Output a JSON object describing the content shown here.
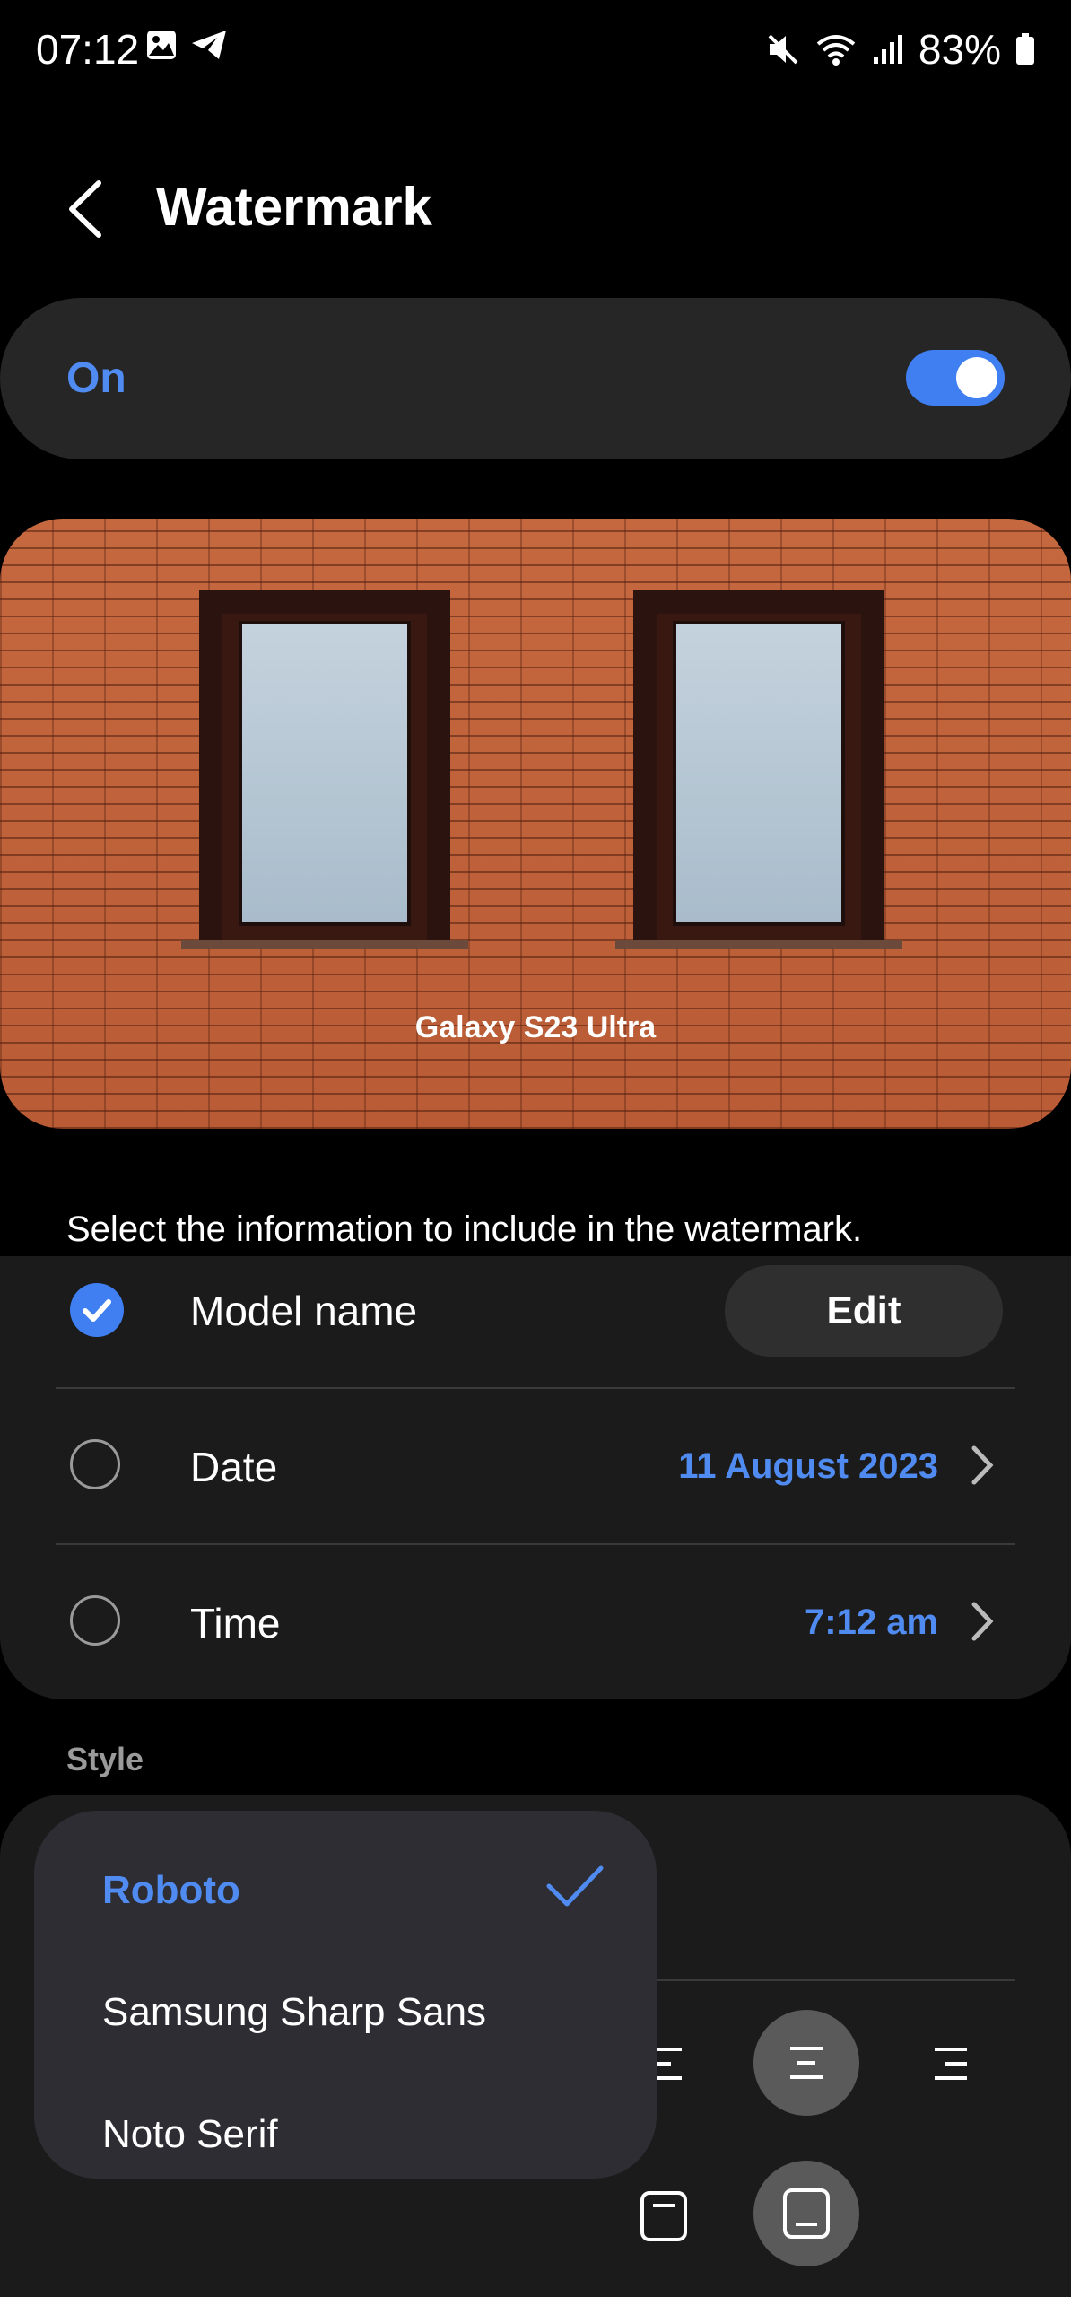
{
  "status_bar": {
    "time": "07:12",
    "left_icons": [
      "gallery-icon",
      "telegram-icon"
    ],
    "right_icons": [
      "mute-icon",
      "wifi-icon",
      "signal-icon",
      "battery-icon"
    ],
    "battery": "83%"
  },
  "header": {
    "title": "Watermark",
    "back_icon": "back-arrow-icon"
  },
  "toggle": {
    "label": "On",
    "state": "on"
  },
  "preview": {
    "watermark_text": "Galaxy S23 Ultra"
  },
  "info": {
    "description": "Select the information to include in the watermark.",
    "rows": [
      {
        "label": "Model name",
        "checked": true,
        "action": "Edit"
      },
      {
        "label": "Date",
        "checked": false,
        "value": "11 August 2023"
      },
      {
        "label": "Time",
        "checked": false,
        "value": "7:12 am"
      }
    ]
  },
  "style": {
    "section_label": "Style",
    "font_menu": {
      "options": [
        "Roboto",
        "Samsung Sharp Sans",
        "Noto Serif"
      ],
      "selected": "Roboto"
    }
  },
  "colors": {
    "accent": "#3f7ff2",
    "accent_text": "#4f8bf0",
    "card": "#1b1b1b"
  }
}
